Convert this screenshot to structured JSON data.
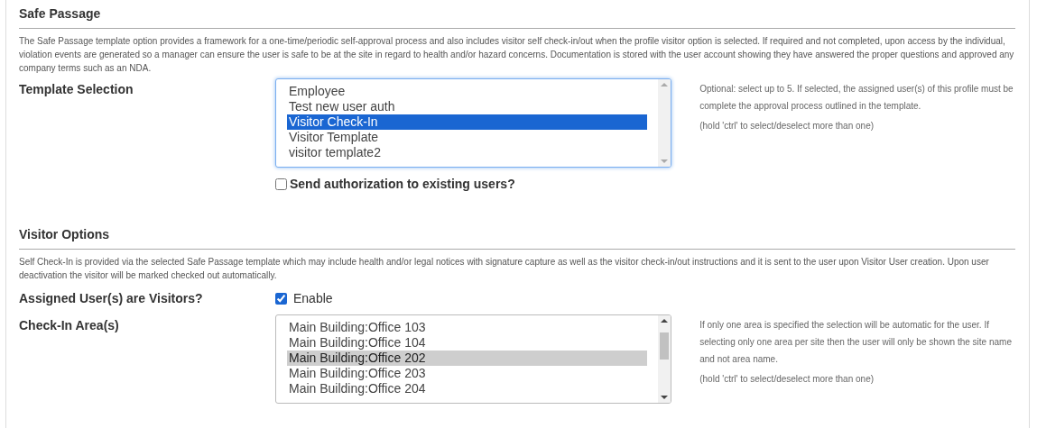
{
  "sections": [
    {
      "title": "Safe Passage",
      "description": "The Safe Passage template option provides a framework for a one-time/periodic self-approval process and also includes visitor self check-in/out when the profile visitor option is selected. If required and not completed, upon access by the individual, violation events are generated so a manager can ensure the user is safe to be at the site in regard to health and/or hazard concerns. Documentation is stored with the user account showing they have answered the proper questions and approved any company terms such as an NDA.",
      "fields": [
        {
          "kind": "listbox",
          "label": "Template Selection",
          "focused": true,
          "options": [
            {
              "label": "Employee",
              "selected": false
            },
            {
              "label": "Test new user auth",
              "selected": false
            },
            {
              "label": "Visitor Check-In",
              "selected": true
            },
            {
              "label": "Visitor Template",
              "selected": false
            },
            {
              "label": "visitor template2",
              "selected": false
            }
          ],
          "help": [
            "Optional: select up to 5. If selected, the assigned user(s) of this profile must be complete the approval process outlined in the template.",
            "(hold 'ctrl' to select/deselect more than one)"
          ]
        },
        {
          "kind": "checkbox",
          "label": "Send authorization to existing users?",
          "checked": false
        }
      ]
    },
    {
      "title": "Visitor Options",
      "description": "Self Check-In is provided via the selected Safe Passage template which may include health and/or legal notices with signature capture as well as the visitor check-in/out instructions and it is sent to the user upon Visitor User creation. Upon user deactivation the visitor will be marked checked out automatically.",
      "fields": [
        {
          "kind": "labeled_checkbox",
          "label": "Assigned User(s) are Visitors?",
          "option": "Enable",
          "checked": true
        },
        {
          "kind": "listbox",
          "label": "Check-In Area(s)",
          "focused": false,
          "options": [
            {
              "label": "Main Building:Office 103",
              "selected": false
            },
            {
              "label": "Main Building:Office 104",
              "selected": false
            },
            {
              "label": "Main Building:Office 202",
              "selected": true
            },
            {
              "label": "Main Building:Office 203",
              "selected": false
            },
            {
              "label": "Main Building:Office 204",
              "selected": false
            }
          ],
          "help": [
            "If only one area is specified the selection will be automatic for the user. If selecting only one area per site then the user will only be shown the site name and not area name.",
            "(hold 'ctrl' to select/deselect more than one)"
          ]
        }
      ]
    }
  ]
}
